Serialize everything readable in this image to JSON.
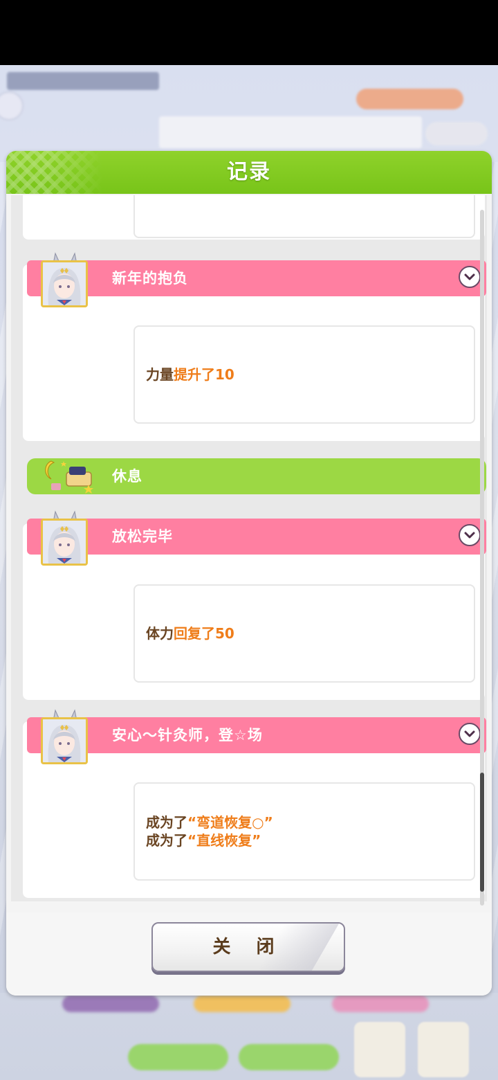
{
  "dialog": {
    "title": "记录",
    "close_label": "关 闭"
  },
  "colors": {
    "header_green": "#78c419",
    "event_pink": "#ff7fa1",
    "rest_green": "#9cd844",
    "highlight_orange": "#ef7d1a",
    "text_brown": "#6a4523"
  },
  "entries": [
    {
      "type": "event",
      "title": "新年的抱负",
      "lines": [
        {
          "prefix": "力量",
          "highlight": "提升了10"
        }
      ]
    },
    {
      "type": "rest",
      "title": "休息"
    },
    {
      "type": "event",
      "title": "放松完毕",
      "lines": [
        {
          "prefix": "体力",
          "highlight": "回复了50"
        }
      ]
    },
    {
      "type": "event",
      "title": "安心～针灸师，登☆场",
      "lines": [
        {
          "prefix": "成为了",
          "highlight": "“弯道恢复○”"
        },
        {
          "prefix": "成为了",
          "highlight": "“直线恢复”"
        }
      ]
    }
  ]
}
